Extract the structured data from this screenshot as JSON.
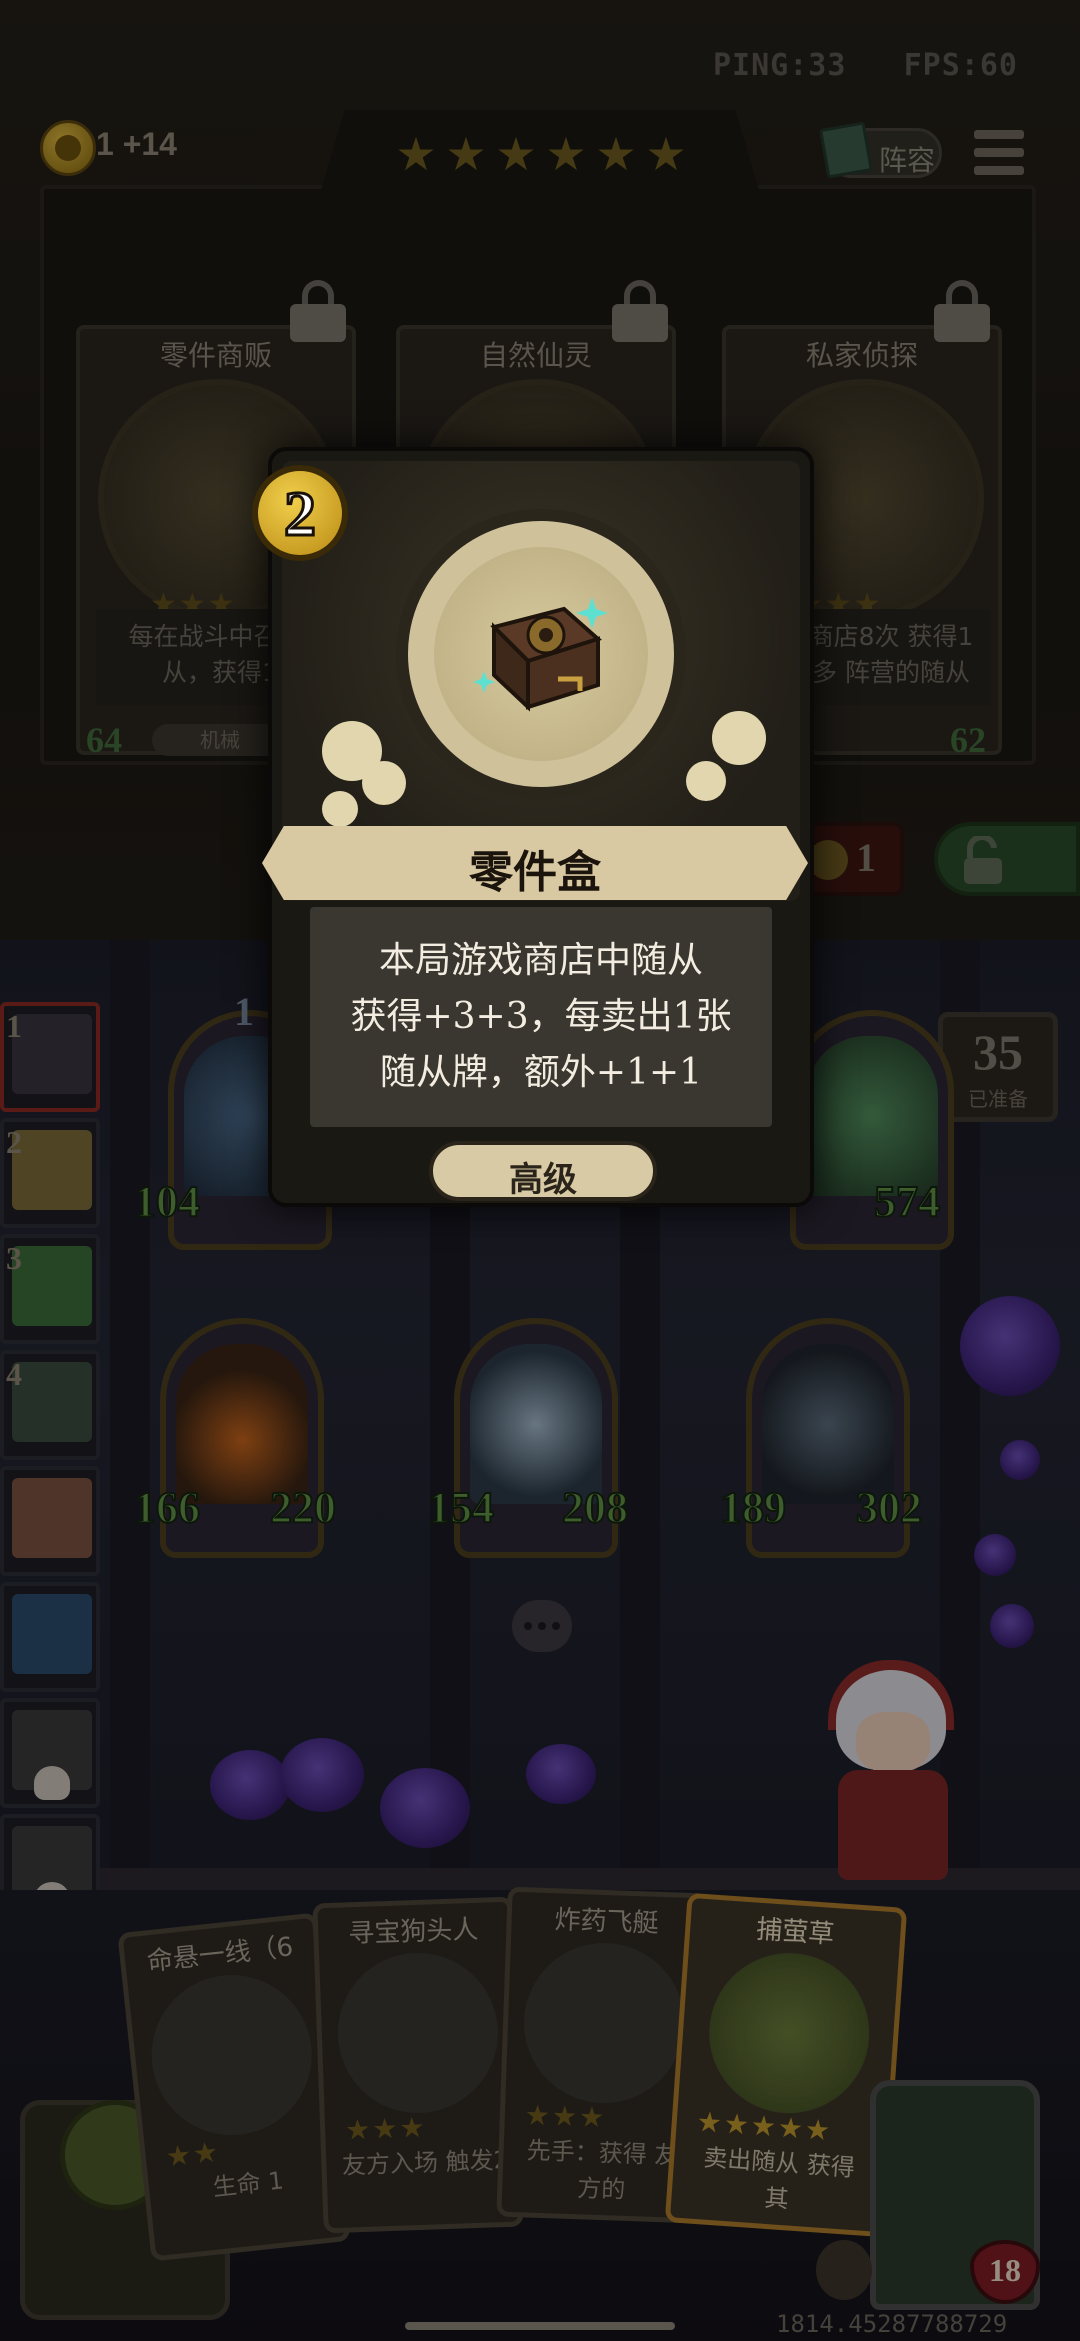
{
  "hud": {
    "ping": "PING:33",
    "fps": "FPS:60",
    "gold": "1 +14",
    "tavern_stars": 6,
    "lineup_label": "阵容"
  },
  "shop": {
    "cards": [
      {
        "name": "零件商贩",
        "desc": "每在战斗中召 随从，获得1",
        "atk": "64",
        "tag": "机械",
        "stars": 3
      },
      {
        "name": "自然仙灵",
        "desc": "",
        "atk": "",
        "tag": "",
        "stars": 0
      },
      {
        "name": "私家侦探",
        "desc": "刷新商店8次 获得1张你多 阵营的随从",
        "hp": "62",
        "tag": "",
        "stars": 3
      }
    ],
    "refresh_cost": "1"
  },
  "board": {
    "ready_count": "35",
    "ready_label": "已准备",
    "top_left_level": "1",
    "minions_row1": [
      {
        "atk": "104",
        "hp": ""
      },
      {
        "atk": "",
        "hp": "574"
      }
    ],
    "minions_row2": [
      {
        "atk": "166",
        "hp": "220"
      },
      {
        "atk": "154",
        "hp": "208"
      },
      {
        "atk": "189",
        "hp": "302"
      }
    ]
  },
  "opponents": [
    {
      "rank": "1",
      "dead": false
    },
    {
      "rank": "2",
      "dead": false
    },
    {
      "rank": "3",
      "dead": false
    },
    {
      "rank": "4",
      "dead": false
    },
    {
      "rank": "",
      "dead": false
    },
    {
      "rank": "",
      "dead": false
    },
    {
      "rank": "",
      "dead": true
    },
    {
      "rank": "",
      "dead": true
    }
  ],
  "hand": [
    {
      "title": "命悬一线（6",
      "text": "生命 1"
    },
    {
      "title": "寻宝狗头人",
      "text": "友方入场 触发2"
    },
    {
      "title": "炸药飞艇",
      "text": "先手：获得 友方的"
    },
    {
      "title": "捕萤草",
      "text": "卖出随从 获得其"
    }
  ],
  "hero": {
    "hp": "18"
  },
  "coords": "1814.45287788729",
  "popup": {
    "cost": "2",
    "name": "零件盒",
    "desc_lines": [
      "本局游戏商店中随从",
      "获得+3+3，每卖出1张",
      "随从牌，额外+1+1"
    ],
    "tier": "高级"
  },
  "colors": {
    "gold": "#d9b43e",
    "stat_green": "#5f8f45",
    "banner": "#d9c9a2",
    "desc_bg": "#3a3630"
  }
}
